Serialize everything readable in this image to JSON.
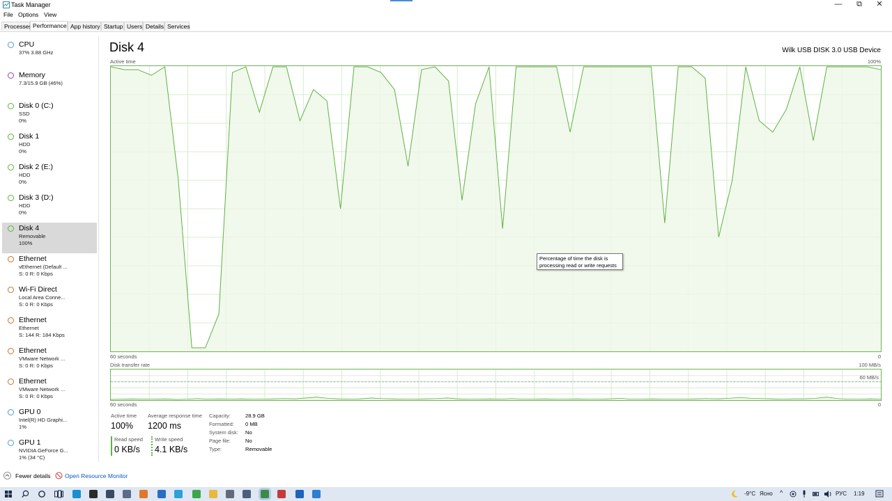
{
  "window": {
    "title": "Task Manager",
    "minimize_glyph": "—",
    "maximize_glyph": "⧉",
    "close_glyph": "✕"
  },
  "menu": [
    "File",
    "Options",
    "View"
  ],
  "tabs": [
    "Processes",
    "Performance",
    "App history",
    "Startup",
    "Users",
    "Details",
    "Services"
  ],
  "active_tab": "Performance",
  "sidebar": [
    {
      "name": "CPU",
      "line1": "37%  3.88 GHz",
      "line2": "",
      "color": "#4f97d6"
    },
    {
      "name": "Memory",
      "line1": "7.3/15.9 GB (46%)",
      "line2": "",
      "color": "#9b3fb6"
    },
    {
      "name": "Disk 0 (C:)",
      "line1": "SSD",
      "line2": "0%",
      "color": "#5db340"
    },
    {
      "name": "Disk 1",
      "line1": "HDD",
      "line2": "0%",
      "color": "#5db340"
    },
    {
      "name": "Disk 2 (E:)",
      "line1": "HDD",
      "line2": "0%",
      "color": "#5db340"
    },
    {
      "name": "Disk 3 (D:)",
      "line1": "HDD",
      "line2": "0%",
      "color": "#5db340"
    },
    {
      "name": "Disk 4",
      "line1": "Removable",
      "line2": "100%",
      "color": "#5db340",
      "selected": true
    },
    {
      "name": "Ethernet",
      "line1": "vEthernet (Default ...",
      "line2": "S: 0  R: 0 Kbps",
      "color": "#c8722d"
    },
    {
      "name": "Wi-Fi Direct",
      "line1": "Local Area Conne...",
      "line2": "S: 0  R: 0 Kbps",
      "color": "#c8722d"
    },
    {
      "name": "Ethernet",
      "line1": "Ethernet",
      "line2": "S: 144  R: 184 Kbps",
      "color": "#c8722d"
    },
    {
      "name": "Ethernet",
      "line1": "VMware Network ...",
      "line2": "S: 0  R: 0 Kbps",
      "color": "#c8722d"
    },
    {
      "name": "Ethernet",
      "line1": "VMware Network ...",
      "line2": "S: 0  R: 0 Kbps",
      "color": "#c8722d"
    },
    {
      "name": "GPU 0",
      "line1": "Intel(R) HD Graphi...",
      "line2": "1%",
      "color": "#4f97d6"
    },
    {
      "name": "GPU 1",
      "line1": "NVIDIA GeForce G...",
      "line2": "1% (34 °C)",
      "color": "#4f97d6"
    }
  ],
  "main": {
    "title": "Disk 4",
    "device": "Wilk USB DISK 3.0 USB Device",
    "active_time_label": "Active time",
    "max_label": "100%",
    "seconds_label": "60 seconds",
    "zero_label": "0",
    "transfer_label": "Disk transfer rate",
    "transfer_max": "100 MB/s",
    "transfer_mid": "60 MB/s",
    "tooltip": "Percentage of time the disk is processing read or write requests"
  },
  "active_time_series": [
    100,
    99,
    99,
    97,
    100,
    60,
    1,
    1,
    13,
    98,
    100,
    84,
    100,
    100,
    81,
    92,
    88,
    50,
    100,
    100,
    98,
    92,
    65,
    99,
    100,
    95,
    53,
    87,
    100,
    43,
    100,
    100,
    100,
    100,
    77,
    100,
    100,
    100,
    100,
    100,
    100,
    45,
    100,
    100,
    96,
    40,
    60,
    100,
    81,
    77,
    85,
    100,
    74,
    100,
    100,
    100,
    100,
    99
  ],
  "transfer_series": [
    0,
    1,
    2,
    1,
    1,
    2,
    0,
    1,
    3,
    1,
    2,
    1,
    2,
    1,
    1,
    2,
    3,
    2,
    5,
    8,
    4,
    2,
    1,
    2,
    5,
    3,
    2,
    1,
    1,
    2,
    3,
    5,
    2,
    1,
    1,
    2,
    1,
    3,
    1,
    1,
    2,
    1,
    1,
    2,
    1,
    1,
    2,
    4,
    1,
    1,
    2,
    1,
    1,
    1,
    2,
    3,
    2,
    4,
    7,
    4,
    3,
    2,
    1,
    2,
    2,
    4,
    8,
    3,
    1,
    1,
    2,
    1
  ],
  "stats": {
    "active_time_label": "Active time",
    "active_time_value": "100%",
    "response_label": "Average response time",
    "response_value": "1200 ms",
    "read_label": "Read speed",
    "read_value": "0 KB/s",
    "write_label": "Write speed",
    "write_value": "4.1 KB/s"
  },
  "properties": [
    {
      "key": "Capacity:",
      "value": "28.9 GB"
    },
    {
      "key": "Formatted:",
      "value": "0 MB"
    },
    {
      "key": "System disk:",
      "value": "No"
    },
    {
      "key": "Page file:",
      "value": "No"
    },
    {
      "key": "Type:",
      "value": "Removable"
    }
  ],
  "footer": {
    "fewer_details": "Fewer details",
    "resource_monitor": "Open Resource Monitor"
  },
  "taskbar": {
    "weather": "-9°C",
    "weather_desc": "Ясно",
    "language": "РУС",
    "time": "1:19"
  },
  "colors": {
    "disk_green": "#5db340",
    "graph_fill": "#eef7e9",
    "grid": "#d6ecce"
  }
}
